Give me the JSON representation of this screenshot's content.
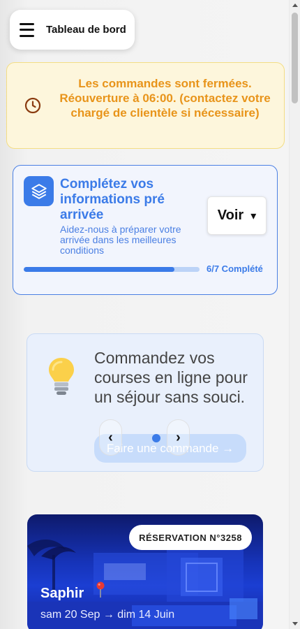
{
  "header": {
    "title": "Tableau de bord",
    "menu_icon": "hamburger-menu-icon"
  },
  "orders_banner": {
    "message": "Les commandes sont fermées. Réouverture à 06:00. (contactez votre chargé de clientèle si nécessaire)",
    "icon": "clock-icon",
    "text_color": "#e8941a",
    "background": "#fdf6dc"
  },
  "pre_arrival": {
    "title": "Complétez vos informations pré arrivée",
    "subtitle": "Aidez-nous à préparer votre arrivée dans les meilleures conditions",
    "button_label": "Voir",
    "button_caret": "▾",
    "progress_label": "6/7 Complété",
    "progress_done": 6,
    "progress_total": 7,
    "icon": "layers-icon",
    "accent": "#3b7be8"
  },
  "promo": {
    "text": "Commandez vos courses en ligne pour un séjour sans souci.",
    "cta_label": "Faire une commande →",
    "prev_label": "‹",
    "next_label": "›",
    "icon": "lightbulb-icon"
  },
  "reservation": {
    "badge": "RÉSERVATION N°3258",
    "name": "Saphir",
    "dates": "sam 20 Sep → dim 14 Juin",
    "icon": "location-pin-icon"
  }
}
